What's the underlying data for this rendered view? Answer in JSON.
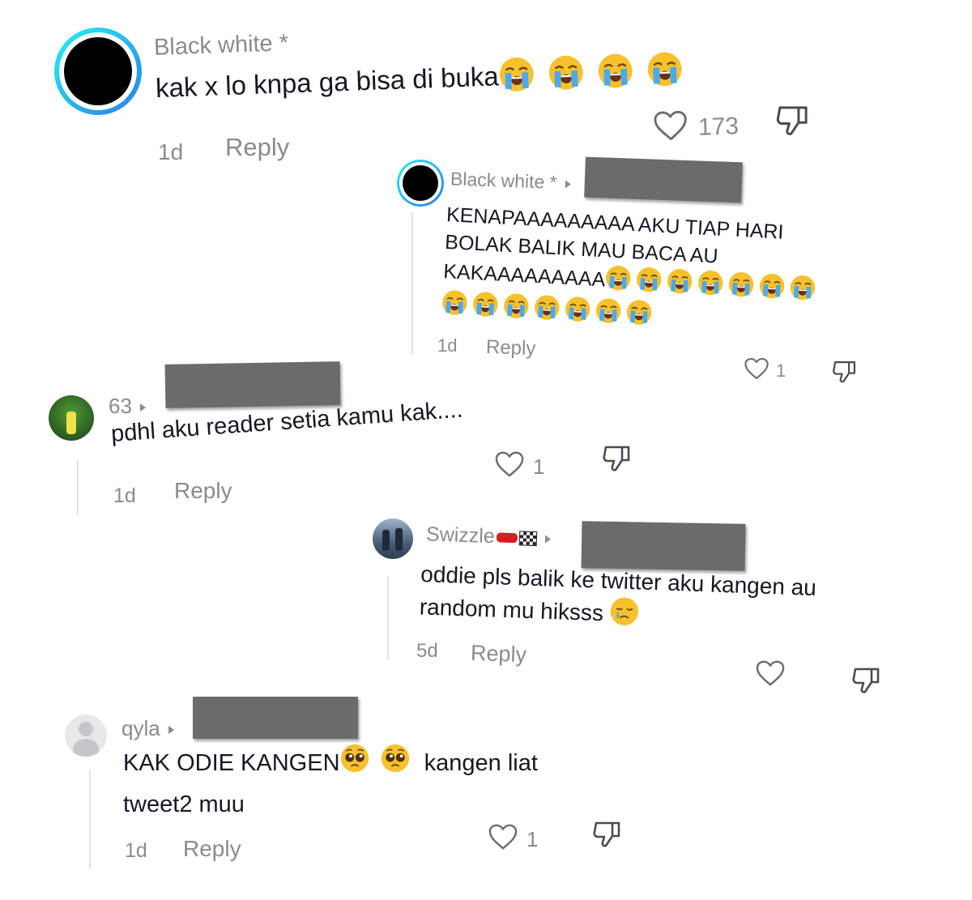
{
  "comments": [
    {
      "username": "Black white *",
      "text": "kak x lo knpa ga bisa di buka",
      "emojis": [
        "sob",
        "sob",
        "sob",
        "sob"
      ],
      "time": "1d",
      "reply_label": "Reply",
      "likes": "173"
    },
    {
      "username": "Black white *",
      "text_lines": [
        "KENAPAAAAAAAAA AKU TIAP HARI",
        "BOLAK BALIK MAU BACA AU",
        "KAKAAAAAAAAA"
      ],
      "emojis": [
        "sob",
        "sob",
        "sob",
        "sob",
        "sob",
        "sob",
        "sob",
        "sob",
        "sob",
        "sob",
        "sob",
        "sob",
        "sob",
        "sob"
      ],
      "time": "1d",
      "reply_label": "Reply",
      "likes": "1"
    },
    {
      "username": "63",
      "text": "pdhl aku reader setia kamu kak....",
      "time": "1d",
      "reply_label": "Reply",
      "likes": "1"
    },
    {
      "username": "Swizzle",
      "username_emojis": [
        "race-car",
        "checkered-flag"
      ],
      "text_lines": [
        "oddie pls balik ke twitter aku kangen au",
        "random mu hiksss"
      ],
      "emojis": [
        "crying-face"
      ],
      "time": "5d",
      "reply_label": "Reply",
      "likes": ""
    },
    {
      "username": "qyla",
      "text_line1": "KAK ODIE KANGEN",
      "emojis": [
        "pleading",
        "pleading"
      ],
      "text_line1_after": "kangen liat",
      "text_line2": "tweet2 muu",
      "time": "1d",
      "reply_label": "Reply",
      "likes": "1"
    }
  ],
  "colors": {
    "text": "#161823",
    "muted": "#8a8b91",
    "redaction": "#6b6b6b",
    "avatar_ring": "#25f4ee"
  }
}
